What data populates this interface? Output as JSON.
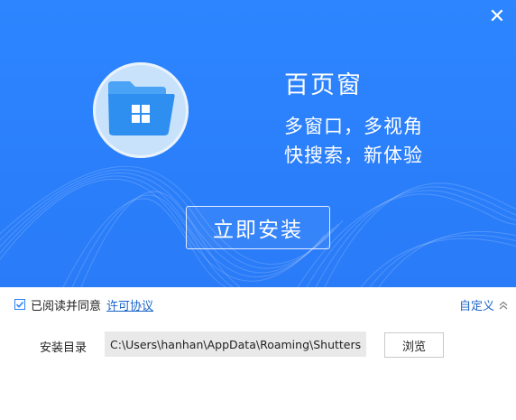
{
  "window": {
    "close_glyph": "✕"
  },
  "hero": {
    "title": "百页窗",
    "tagline_line1": "多窗口，多视角",
    "tagline_line2": "快搜索，新体验",
    "install_button": "立即安装",
    "logo_icon": "folder-windows-icon"
  },
  "agreement": {
    "checked": true,
    "text": "已阅读并同意",
    "link": "许可协议"
  },
  "custom": {
    "label": "自定义",
    "chevron": "up"
  },
  "install_dir": {
    "label": "安装目录",
    "path": "C:\\Users\\hanhan\\AppData\\Roaming\\Shutters",
    "browse_button": "浏览"
  },
  "colors": {
    "hero_blue": "#2b7ffb",
    "link_blue": "#1a64c8",
    "logo_bg": "#c9e2fb",
    "folder_blue": "#2e8ff0"
  }
}
